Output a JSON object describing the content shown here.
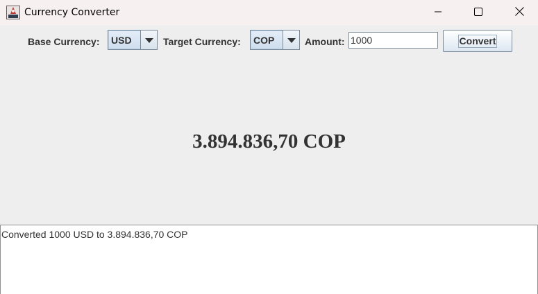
{
  "window": {
    "title": "Currency Converter",
    "icons": {
      "app": "java-app-icon",
      "minimize": "minimize-icon",
      "maximize": "maximize-icon",
      "close": "close-icon"
    }
  },
  "controls": {
    "base_label": "Base Currency:",
    "base_value": "USD",
    "target_label": "Target Currency:",
    "target_value": "COP",
    "amount_label": "Amount:",
    "amount_value": "1000",
    "convert_label": "Convert"
  },
  "result": {
    "text": "3.894.836,70 COP"
  },
  "log": {
    "lines": [
      "Converted 1000 USD to 3.894.836,70 COP"
    ]
  },
  "colors": {
    "titlebar": "#f7f0f0",
    "panel": "#eeeeee",
    "text": "#333333"
  }
}
